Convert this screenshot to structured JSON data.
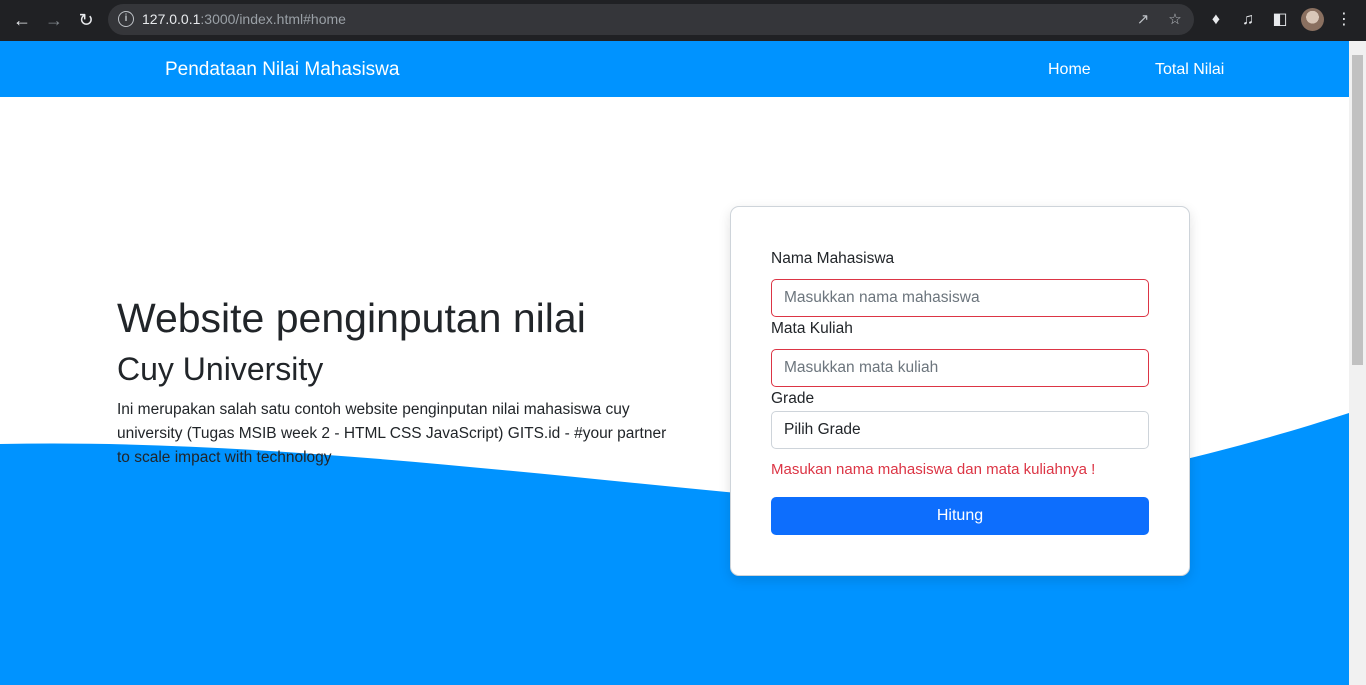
{
  "browser": {
    "url_host": "127.0.0.1",
    "url_rest": ":3000/index.html#home"
  },
  "navbar": {
    "brand": "Pendataan Nilai Mahasiswa",
    "links": [
      "Home",
      "Total Nilai"
    ]
  },
  "hero": {
    "title": "Website penginputan nilai",
    "subtitle": "Cuy University",
    "description": "Ini merupakan salah satu contoh website penginputan nilai mahasiswa cuy university (Tugas MSIB week 2 - HTML CSS JavaScript) GITS.id - #your partner to scale impact with technology"
  },
  "form": {
    "name_label": "Nama Mahasiswa",
    "name_placeholder": "Masukkan nama mahasiswa",
    "name_value": "",
    "course_label": "Mata Kuliah",
    "course_placeholder": "Masukkan mata kuliah",
    "course_value": "",
    "grade_label": "Grade",
    "grade_selected": "Pilih Grade",
    "error_message": "Masukan nama mahasiswa dan mata kuliahnya !",
    "submit_label": "Hitung"
  },
  "colors": {
    "brand_blue": "#0093ff",
    "button_blue": "#0d6efd",
    "error_red": "#dc3545"
  },
  "icons": [
    "back-icon",
    "forward-icon",
    "reload-icon",
    "info-icon",
    "share-icon",
    "star-icon",
    "extensions-icon",
    "media-icon",
    "side-panel-icon",
    "avatar",
    "menu-icon"
  ]
}
